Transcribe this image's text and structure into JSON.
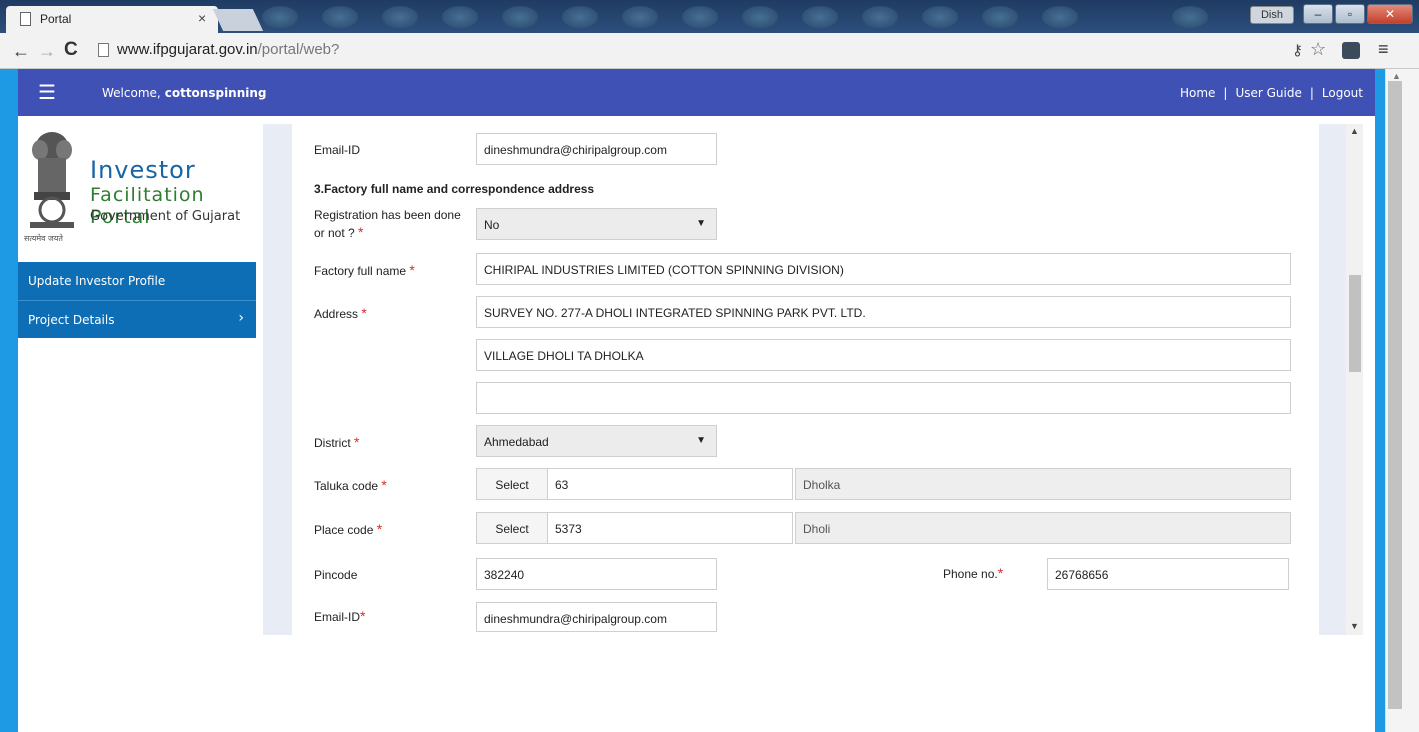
{
  "browser": {
    "tab_title": "Portal",
    "tab_close": "×",
    "url_host": "www.ifpgujarat.gov.in",
    "url_path": "/portal/web?",
    "profile_button": "Dish"
  },
  "header": {
    "welcome_label": "Welcome,",
    "username": "cottonspinning",
    "links": [
      "Home",
      "User Guide",
      "Logout"
    ],
    "separator": "|"
  },
  "logo": {
    "line1": "Investor",
    "line2": "Facilitation Portal",
    "line3": "Government of Gujarat",
    "emblem_caption": "सत्यमेव जयते"
  },
  "sidebar": {
    "items": [
      {
        "label": "Update Investor Profile"
      },
      {
        "label": "Project Details",
        "chevron": "›"
      }
    ]
  },
  "form": {
    "email_top_label": "Email-ID",
    "email_top_value": "dineshmundra@chiripalgroup.com",
    "section3_title": "3.Factory full name and correspondence address",
    "registration_label_l1": "Registration has been done",
    "registration_label_l2": "or not ?",
    "registration_value": "No",
    "factory_name_label": "Factory full name",
    "factory_name_value": "CHIRIPAL INDUSTRIES LIMITED (COTTON SPINNING DIVISION)",
    "address_label": "Address",
    "address_line1": "SURVEY NO. 277-A DHOLI INTEGRATED SPINNING PARK PVT. LTD.",
    "address_line2": "VILLAGE DHOLI TA DHOLKA",
    "address_line3": "",
    "district_label": "District",
    "district_value": "Ahmedabad",
    "taluka_label": "Taluka code",
    "taluka_select": "Select",
    "taluka_code": "63",
    "taluka_name": "Dholka",
    "place_label": "Place code",
    "place_select": "Select",
    "place_code": "5373",
    "place_name": "Dholi",
    "pincode_label": "Pincode",
    "pincode_value": "382240",
    "phone_label": "Phone no.",
    "phone_value": "26768656",
    "email_label": "Email-ID",
    "email_value": "dineshmundra@chiripalgroup.com",
    "required_mark": "*",
    "dropdown_arrow": "▼"
  },
  "colors": {
    "header_bg": "#3f51b5",
    "sidebar_item_bg": "#0d6eb5",
    "side_strip": "#1e9ae4",
    "required": "#d32f2f"
  }
}
